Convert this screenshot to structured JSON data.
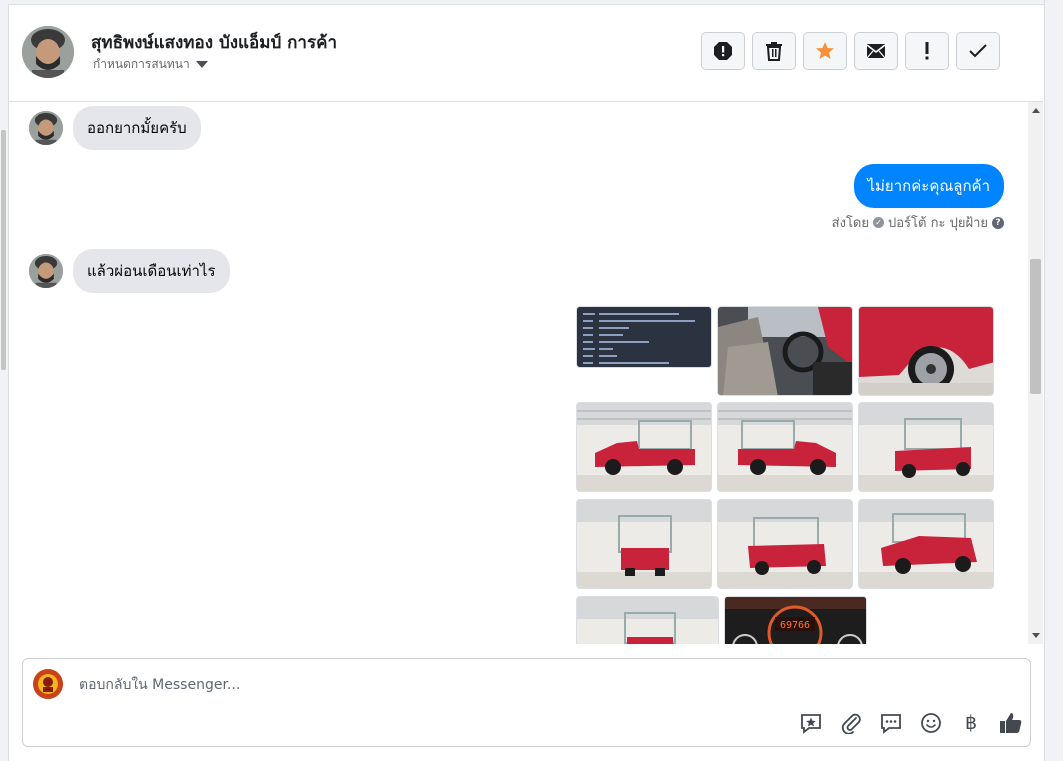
{
  "header": {
    "contact_name": "สุทธิพงษ์แสงทอง บังแอ็มป์ การค้า",
    "assign_label": "กำหนดการสนทนา",
    "actions": [
      {
        "name": "spam-button",
        "icon": "alert-octagon-icon"
      },
      {
        "name": "delete-button",
        "icon": "trash-icon"
      },
      {
        "name": "star-button",
        "icon": "star-icon"
      },
      {
        "name": "mark-unread-button",
        "icon": "envelope-icon"
      },
      {
        "name": "follow-up-button",
        "icon": "exclamation-icon"
      },
      {
        "name": "done-button",
        "icon": "checkmark-icon"
      }
    ],
    "star_color": "#f7923b"
  },
  "messages": [
    {
      "direction": "incoming",
      "text": "ออกยากมั้ยครับ"
    },
    {
      "direction": "outgoing",
      "text": "ไม่ยากค่ะคุณลูกค้า"
    },
    {
      "direction": "incoming",
      "text": "แล้วผ่อนเดือนเท่าไร"
    }
  ],
  "sent_by": {
    "prefix": "ส่งโดย",
    "sender": "ปอร์โต้ กะ ปุยฝ้าย"
  },
  "photos": {
    "count": 11,
    "dashboard_readout": "69766"
  },
  "composer": {
    "placeholder": "ตอบกลับใน Messenger...",
    "tools": [
      "saved-reply-icon",
      "attachment-icon",
      "chat-bubble-icon",
      "emoji-icon",
      "baht-icon",
      "thumbs-up-icon"
    ],
    "baht_symbol": "฿"
  },
  "colors": {
    "accent": "#0084ff",
    "bubble_in": "#e4e6eb",
    "car_red": "#c8233a"
  }
}
